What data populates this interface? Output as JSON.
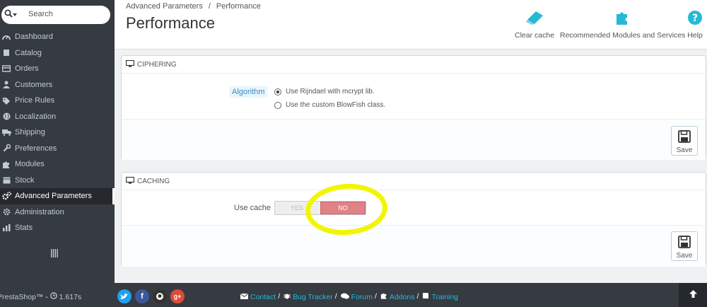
{
  "sidebar": {
    "search_label": "Search",
    "items": [
      {
        "label": "Dashboard",
        "icon": "dashboard-icon",
        "active": false
      },
      {
        "label": "Catalog",
        "icon": "catalog-icon",
        "active": false
      },
      {
        "label": "Orders",
        "icon": "orders-icon",
        "active": false
      },
      {
        "label": "Customers",
        "icon": "customers-icon",
        "active": false
      },
      {
        "label": "Price Rules",
        "icon": "price-rules-icon",
        "active": false
      },
      {
        "label": "Localization",
        "icon": "globe-icon",
        "active": false
      },
      {
        "label": "Shipping",
        "icon": "truck-icon",
        "active": false
      },
      {
        "label": "Preferences",
        "icon": "wrench-icon",
        "active": false
      },
      {
        "label": "Modules",
        "icon": "puzzle-icon",
        "active": false
      },
      {
        "label": "Stock",
        "icon": "stock-icon",
        "active": false
      },
      {
        "label": "Advanced Parameters",
        "icon": "cogs-icon",
        "active": true
      },
      {
        "label": "Administration",
        "icon": "gear-icon",
        "active": false
      },
      {
        "label": "Stats",
        "icon": "stats-icon",
        "active": false
      }
    ]
  },
  "header": {
    "breadcrumb": [
      "Advanced Parameters",
      "Performance"
    ],
    "breadcrumb_separator": "/",
    "title": "Performance",
    "toolbar": {
      "clear_cache": "Clear cache",
      "recommended_modules": "Recommended Modules and Services",
      "help": "Help"
    }
  },
  "ciphering": {
    "heading": "CIPHERING",
    "algorithm_label": "Algorithm",
    "options": [
      {
        "label": "Use Rijndael with mcrypt lib.",
        "checked": true
      },
      {
        "label": "Use the custom BlowFish class.",
        "checked": false
      }
    ],
    "save_label": "Save"
  },
  "caching": {
    "heading": "CACHING",
    "use_cache_label": "Use cache",
    "yes_label": "YES",
    "no_label": "NO",
    "selected": "NO",
    "save_label": "Save"
  },
  "footer": {
    "brand": "PrestaShop™",
    "load_time": "1.617s",
    "links": [
      {
        "label": "Contact",
        "icon": "envelope-icon"
      },
      {
        "label": "Bug Tracker",
        "icon": "bug-icon"
      },
      {
        "label": "Forum",
        "icon": "comments-icon"
      },
      {
        "label": "Addons",
        "icon": "puzzle-icon"
      },
      {
        "label": "Training",
        "icon": "book-icon"
      }
    ],
    "link_separator": "/",
    "social": [
      "twitter-icon",
      "facebook-icon",
      "github-icon",
      "google-plus-icon"
    ]
  },
  "colors": {
    "sidebar_bg": "#363a41",
    "accent": "#25b9d7",
    "no_switch": "#e08286",
    "highlight": "#f2f500"
  }
}
